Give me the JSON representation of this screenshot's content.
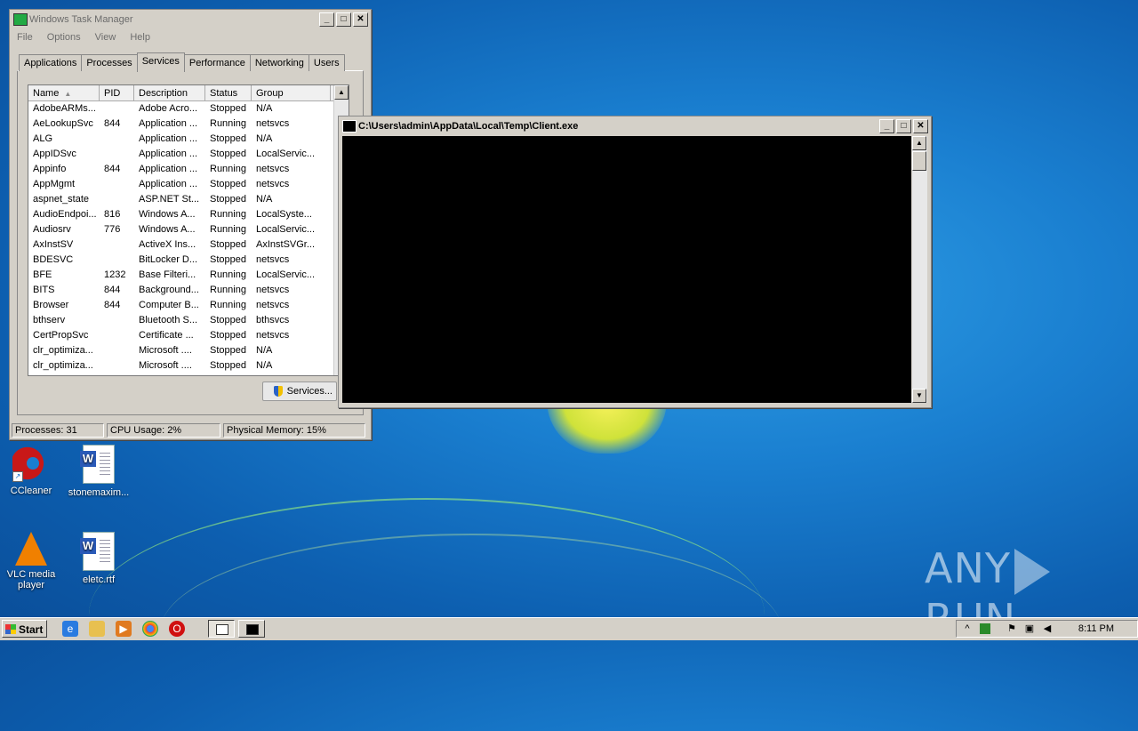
{
  "task_manager": {
    "title": "Windows Task Manager",
    "menu": [
      "File",
      "Options",
      "View",
      "Help"
    ],
    "tabs": [
      "Applications",
      "Processes",
      "Services",
      "Performance",
      "Networking",
      "Users"
    ],
    "active_tab": "Services",
    "columns": [
      "Name",
      "PID",
      "Description",
      "Status",
      "Group"
    ],
    "rows": [
      [
        "AdobeARMs...",
        "",
        "Adobe Acro...",
        "Stopped",
        "N/A"
      ],
      [
        "AeLookupSvc",
        "844",
        "Application ...",
        "Running",
        "netsvcs"
      ],
      [
        "ALG",
        "",
        "Application ...",
        "Stopped",
        "N/A"
      ],
      [
        "AppIDSvc",
        "",
        "Application ...",
        "Stopped",
        "LocalServic..."
      ],
      [
        "Appinfo",
        "844",
        "Application ...",
        "Running",
        "netsvcs"
      ],
      [
        "AppMgmt",
        "",
        "Application ...",
        "Stopped",
        "netsvcs"
      ],
      [
        "aspnet_state",
        "",
        "ASP.NET St...",
        "Stopped",
        "N/A"
      ],
      [
        "AudioEndpoi...",
        "816",
        "Windows A...",
        "Running",
        "LocalSyste..."
      ],
      [
        "Audiosrv",
        "776",
        "Windows A...",
        "Running",
        "LocalServic..."
      ],
      [
        "AxInstSV",
        "",
        "ActiveX Ins...",
        "Stopped",
        "AxInstSVGr..."
      ],
      [
        "BDESVC",
        "",
        "BitLocker D...",
        "Stopped",
        "netsvcs"
      ],
      [
        "BFE",
        "1232",
        "Base Filteri...",
        "Running",
        "LocalServic..."
      ],
      [
        "BITS",
        "844",
        "Background...",
        "Running",
        "netsvcs"
      ],
      [
        "Browser",
        "844",
        "Computer B...",
        "Running",
        "netsvcs"
      ],
      [
        "bthserv",
        "",
        "Bluetooth S...",
        "Stopped",
        "bthsvcs"
      ],
      [
        "CertPropSvc",
        "",
        "Certificate ...",
        "Stopped",
        "netsvcs"
      ],
      [
        "clr_optimiza...",
        "",
        "Microsoft ....",
        "Stopped",
        "N/A"
      ],
      [
        "clr_optimiza...",
        "",
        "Microsoft ....",
        "Stopped",
        "N/A"
      ]
    ],
    "services_button": "Services...",
    "status": {
      "processes": "Processes: 31",
      "cpu": "CPU Usage: 2%",
      "memory": "Physical Memory: 15%"
    }
  },
  "console": {
    "title": "C:\\Users\\admin\\AppData\\Local\\Temp\\Client.exe"
  },
  "desktop_icons": [
    {
      "label": "CCleaner",
      "icon": "ccleaner-icon"
    },
    {
      "label": "stonemaxim...",
      "icon": "word-document-icon"
    },
    {
      "label": "VLC media player",
      "icon": "vlc-icon"
    },
    {
      "label": "eletc.rtf",
      "icon": "word-document-icon"
    }
  ],
  "taskbar": {
    "start_label": "Start",
    "clock": "8:11 PM"
  },
  "watermark": {
    "left": "ANY",
    "right": "RUN"
  }
}
